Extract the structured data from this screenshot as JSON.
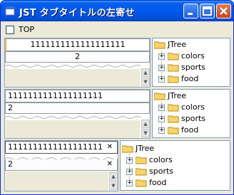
{
  "window": {
    "title": "JST タブタイトルの左寄せ"
  },
  "top_checkbox": {
    "label": "TOP",
    "checked": false
  },
  "tabs": {
    "first": "1111111111111111111",
    "second": "2"
  },
  "tree": {
    "root": "JTree",
    "children": [
      "colors",
      "sports",
      "food"
    ]
  },
  "colors": {
    "titlebar": "#0058ee",
    "close_button": "#c9421c",
    "folder": "#f7d46a",
    "tab_highlight": "#f9b04e"
  },
  "icons": {
    "folder": "folder-icon",
    "expand": "expand-plus-icon",
    "close_tab": "close-tab-icon"
  }
}
